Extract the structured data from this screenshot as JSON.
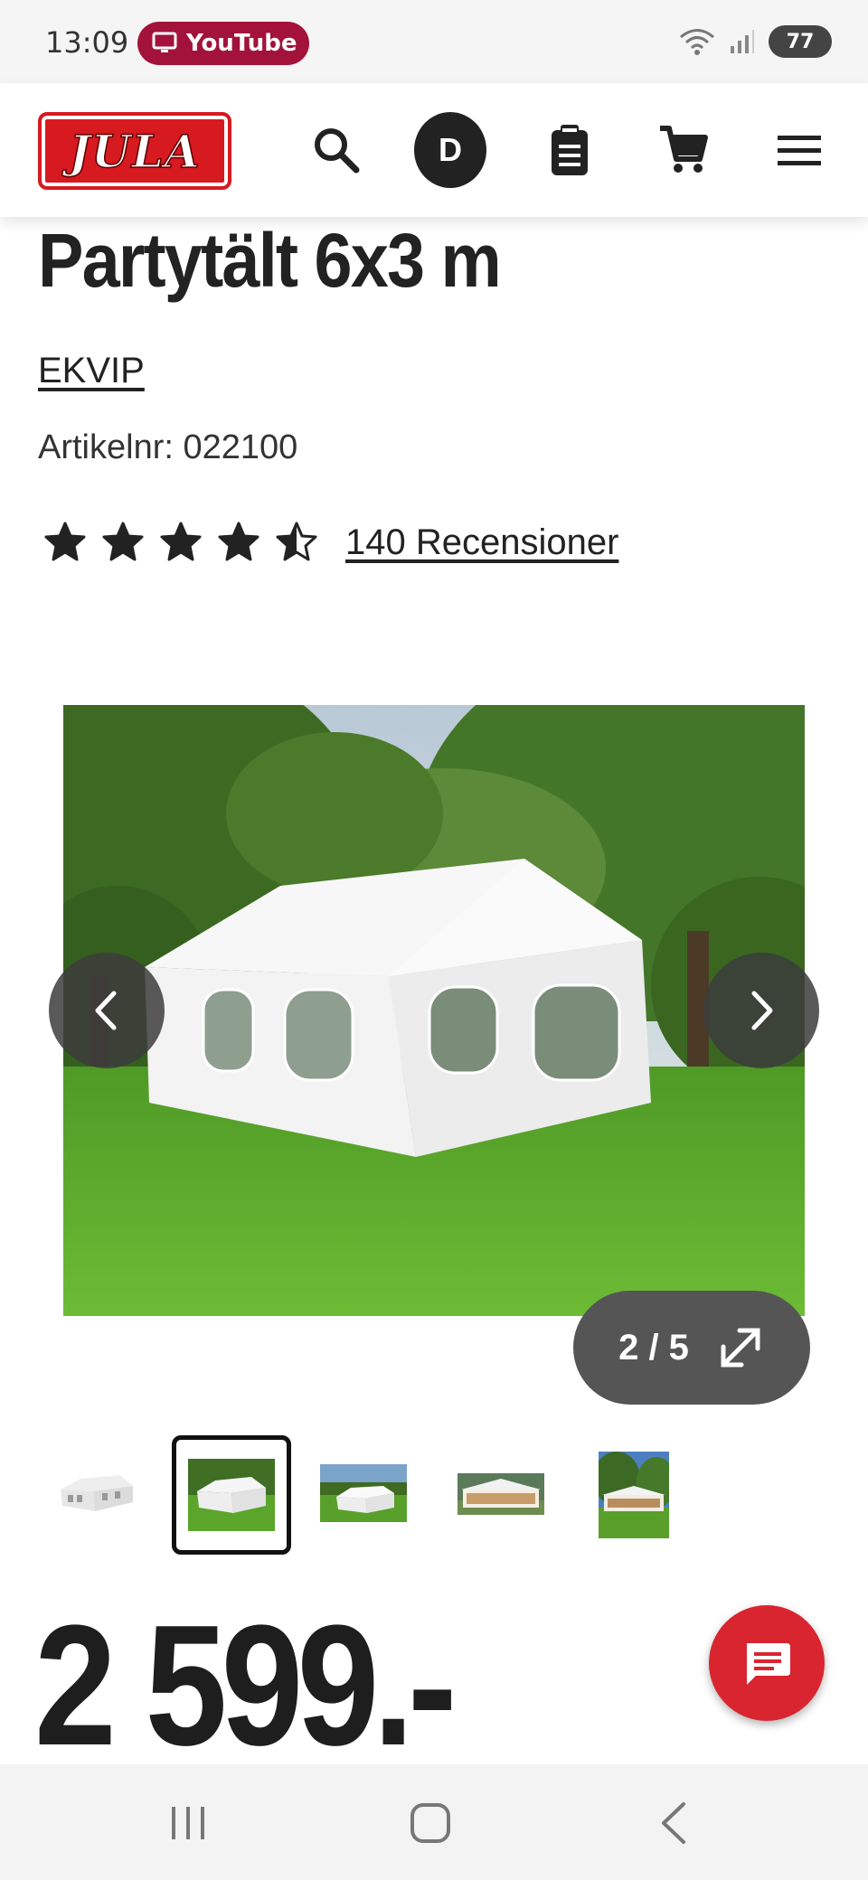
{
  "status_bar": {
    "time": "13:09",
    "app_pill_label": "YouTube",
    "battery": "77"
  },
  "header": {
    "logo_text": "JULA",
    "avatar_initial": "D",
    "icons": [
      "search-icon",
      "clipboard-icon",
      "cart-icon",
      "menu-icon"
    ]
  },
  "product": {
    "title": "Partytält 6x3 m",
    "brand": "EKVIP",
    "article_number": "Artikelnr: 022100",
    "rating": 4.5,
    "rating_max": 5,
    "reviews_label": "140 Recensioner",
    "price": "2 599.-"
  },
  "gallery": {
    "counter": "2 / 5",
    "current_index": 2,
    "total": 5,
    "thumbnails": [
      "thumb-1",
      "thumb-2",
      "thumb-3",
      "thumb-4",
      "thumb-5"
    ]
  },
  "colors": {
    "brand_red": "#d71920",
    "chat_red": "#d9252f",
    "youtube_pill": "#a3123a",
    "grass_green": "#5aa52a"
  }
}
